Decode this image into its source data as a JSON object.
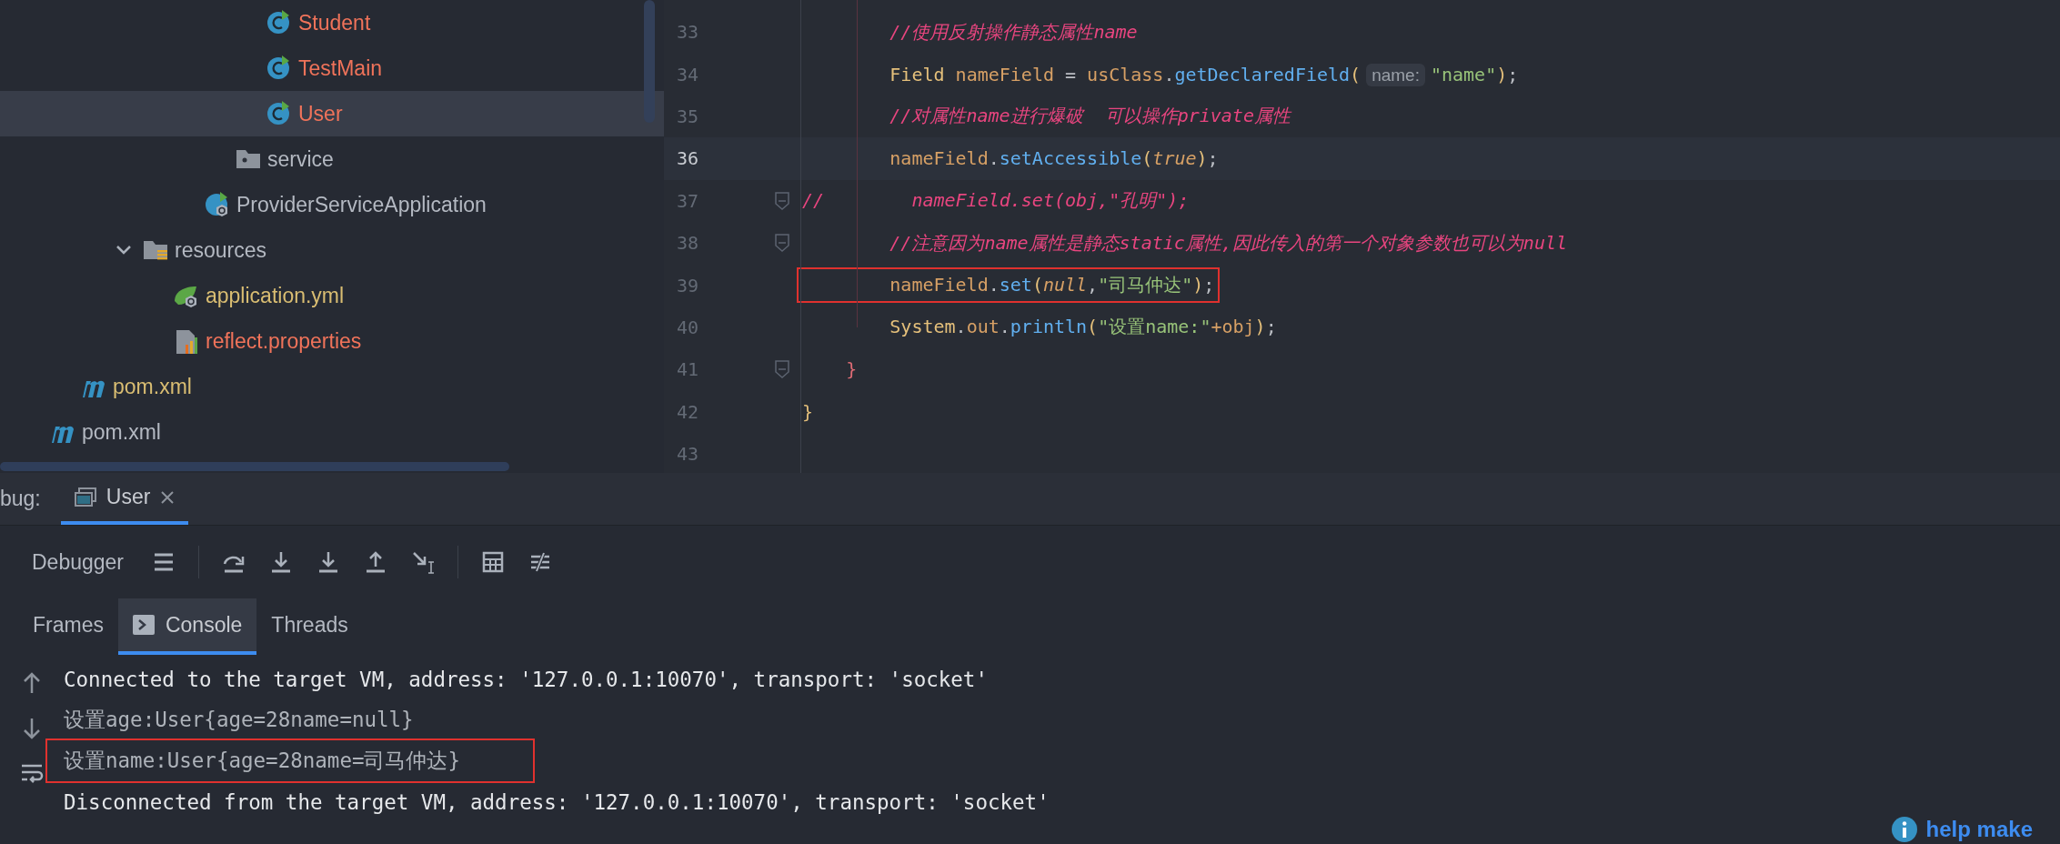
{
  "project_tree": [
    {
      "children": [
        {
          "children": [
            {
              "children": [
                {
                  "children": [
                    {
                      "children": [
                        {
                          "children": [
                            {
                              "children": [
                                {
                                  "label": "Student",
                                  "kind": "class",
                                  "color": "#f0735a",
                                  "selected": false
                                },
                                {
                                  "label": "TestMain",
                                  "kind": "class",
                                  "color": "#f0735a",
                                  "selected": false
                                },
                                {
                                  "label": "User",
                                  "kind": "class",
                                  "color": "#f0735a",
                                  "selected": true
                                }
                              ]
                            },
                            {
                              "label": "service",
                              "kind": "folder",
                              "color": "#b4b9c2",
                              "selected": false
                            }
                          ]
                        },
                        {
                          "label": "ProviderServiceApplication",
                          "kind": "spring-class",
                          "color": "#b4b9c2",
                          "selected": false
                        }
                      ]
                    }
                  ]
                },
                {
                  "label": "resources",
                  "kind": "resource-folder",
                  "color": "#b4b9c2",
                  "selected": false,
                  "expanded": true,
                  "children": [
                    {
                      "label": "application.yml",
                      "kind": "yaml",
                      "color": "#d9bd72",
                      "selected": false
                    },
                    {
                      "label": "reflect.properties",
                      "kind": "properties",
                      "color": "#f0735a",
                      "selected": false
                    }
                  ]
                }
              ]
            }
          ]
        },
        {
          "label": "pom.xml",
          "kind": "maven",
          "color": "#d9bd72",
          "selected": false
        }
      ]
    },
    {
      "label": "pom.xml",
      "kind": "maven",
      "color": "#b4b9c2",
      "selected": false
    }
  ],
  "editor": {
    "lines": [
      {
        "number": "33",
        "current": false,
        "fold": false,
        "boxed": false,
        "tokens": [
          {
            "text": "        //使用反射操作静态属性name",
            "kind": "comment"
          }
        ]
      },
      {
        "number": "34",
        "current": false,
        "fold": false,
        "boxed": false,
        "tokens": [
          {
            "text": "        Field",
            "kind": "type"
          },
          {
            "text": " nameField",
            "kind": "var"
          },
          {
            "text": " = ",
            "kind": "punct"
          },
          {
            "text": "usClass",
            "kind": "var"
          },
          {
            "text": ".",
            "kind": "punct"
          },
          {
            "text": "getDeclaredField",
            "kind": "method"
          },
          {
            "text": "(",
            "kind": "paren"
          },
          {
            "text": "name:",
            "kind": "hint"
          },
          {
            "text": "\"name\"",
            "kind": "string"
          },
          {
            "text": ")",
            "kind": "paren"
          },
          {
            "text": ";",
            "kind": "punct"
          }
        ]
      },
      {
        "number": "35",
        "current": false,
        "fold": false,
        "boxed": false,
        "tokens": [
          {
            "text": "        //对属性name进行爆破  可以操作private属性",
            "kind": "comment"
          }
        ]
      },
      {
        "number": "36",
        "current": true,
        "fold": false,
        "boxed": false,
        "tokens": [
          {
            "text": "        nameField",
            "kind": "var"
          },
          {
            "text": ".",
            "kind": "punct"
          },
          {
            "text": "setAccessible",
            "kind": "method"
          },
          {
            "text": "(",
            "kind": "paren"
          },
          {
            "text": "true",
            "kind": "literal"
          },
          {
            "text": ")",
            "kind": "paren"
          },
          {
            "text": ";",
            "kind": "punct"
          }
        ]
      },
      {
        "number": "37",
        "current": false,
        "fold": true,
        "boxed": false,
        "tokens": [
          {
            "text": "//        nameField.set(obj,\"孔明\");",
            "kind": "comment"
          }
        ]
      },
      {
        "number": "38",
        "current": false,
        "fold": true,
        "boxed": false,
        "tokens": [
          {
            "text": "        //注意因为name属性是静态static属性,因此传入的第一个对象参数也可以为null",
            "kind": "comment"
          }
        ]
      },
      {
        "number": "39",
        "current": false,
        "fold": false,
        "boxed": true,
        "tokens": [
          {
            "text": "        nameField",
            "kind": "var"
          },
          {
            "text": ".",
            "kind": "punct"
          },
          {
            "text": "set",
            "kind": "method"
          },
          {
            "text": "(",
            "kind": "paren"
          },
          {
            "text": "null",
            "kind": "literal"
          },
          {
            "text": ",",
            "kind": "punct"
          },
          {
            "text": "\"司马仲达\"",
            "kind": "string"
          },
          {
            "text": ")",
            "kind": "paren"
          },
          {
            "text": ";",
            "kind": "punct"
          }
        ]
      },
      {
        "number": "40",
        "current": false,
        "fold": false,
        "boxed": false,
        "tokens": [
          {
            "text": "        System",
            "kind": "type"
          },
          {
            "text": ".",
            "kind": "punct"
          },
          {
            "text": "out",
            "kind": "var"
          },
          {
            "text": ".",
            "kind": "punct"
          },
          {
            "text": "println",
            "kind": "method"
          },
          {
            "text": "(",
            "kind": "paren"
          },
          {
            "text": "\"设置name:\"",
            "kind": "string"
          },
          {
            "text": "+obj",
            "kind": "var"
          },
          {
            "text": ")",
            "kind": "paren"
          },
          {
            "text": ";",
            "kind": "punct"
          }
        ]
      },
      {
        "number": "41",
        "current": false,
        "fold": true,
        "boxed": false,
        "tokens": [
          {
            "text": "    }",
            "kind": "brace-outer"
          }
        ]
      },
      {
        "number": "42",
        "current": false,
        "fold": false,
        "boxed": false,
        "tokens": [
          {
            "text": "}",
            "kind": "brace-class"
          }
        ]
      },
      {
        "number": "43",
        "current": false,
        "fold": false
      }
    ]
  },
  "debug": {
    "title": "bug:",
    "tabs": [
      {
        "label": "User",
        "selected": true
      }
    ],
    "toolbar_label": "Debugger",
    "subtabs": [
      {
        "label": "Frames",
        "selected": false
      },
      {
        "label": "Console",
        "selected": true
      },
      {
        "label": "Threads",
        "selected": false
      }
    ],
    "console": [
      {
        "text": "Connected to the target VM, address: '127.0.0.1:10070', transport: 'socket'",
        "boxed": false
      },
      {
        "text": "设置age:User{age=28name=null}",
        "boxed": false
      },
      {
        "text": "设置name:User{age=28name=司马仲达}",
        "boxed": true
      },
      {
        "text": "Disconnected from the target VM, address: '127.0.0.1:10070', transport: 'socket'",
        "boxed": false
      }
    ]
  },
  "notification": {
    "text": "help make"
  }
}
